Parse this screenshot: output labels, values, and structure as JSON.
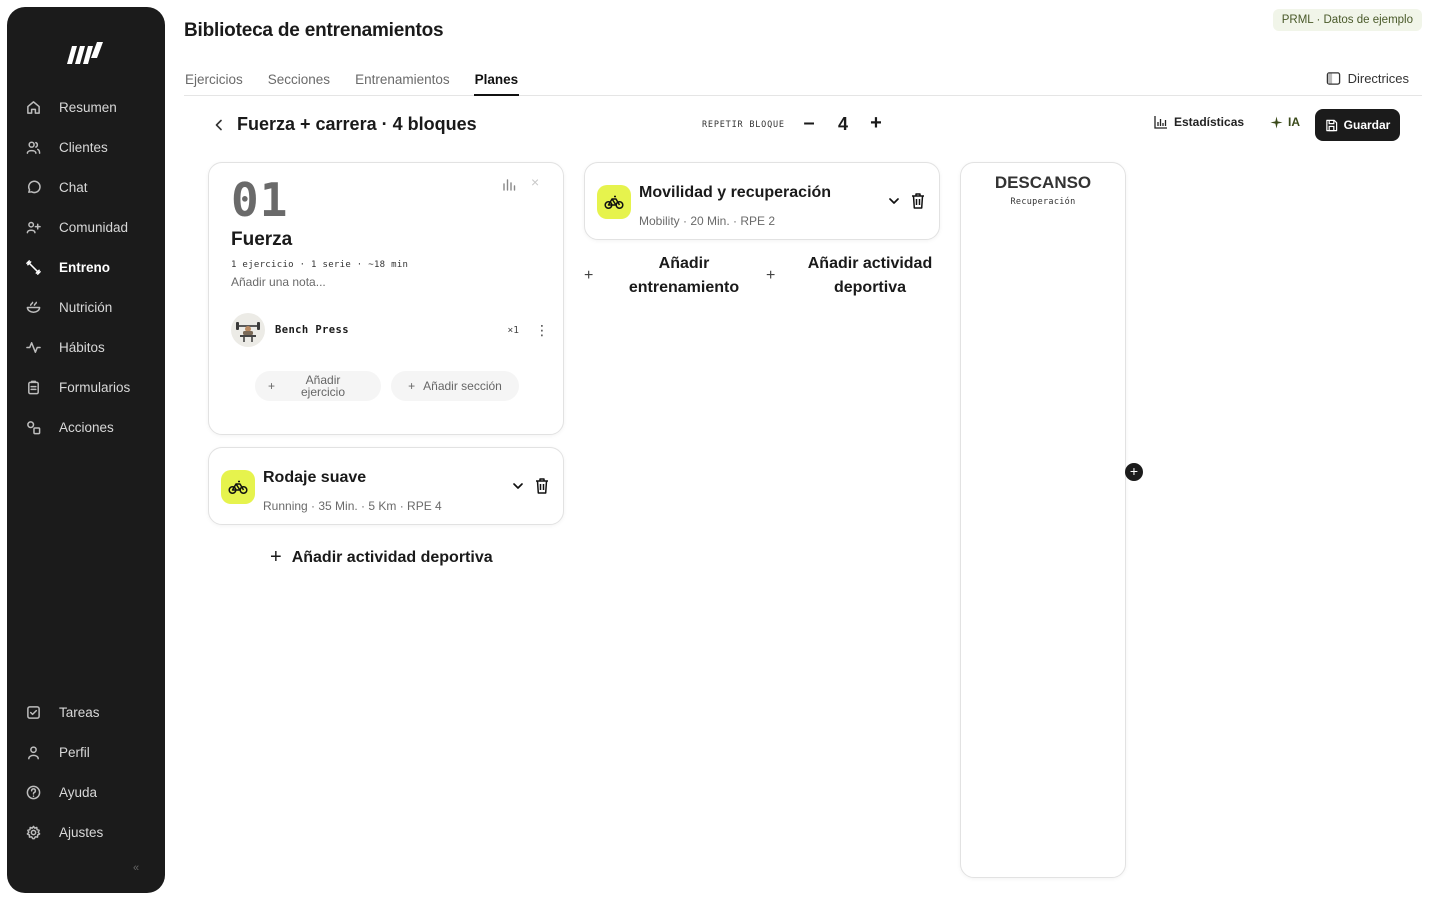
{
  "sidebar": {
    "logo": "logo",
    "items": [
      {
        "label": "Resumen",
        "icon": "home-icon"
      },
      {
        "label": "Clientes",
        "icon": "users-icon"
      },
      {
        "label": "Chat",
        "icon": "chat-icon"
      },
      {
        "label": "Comunidad",
        "icon": "community-icon"
      },
      {
        "label": "Entreno",
        "icon": "dumbbell-icon",
        "active": true
      },
      {
        "label": "Nutrición",
        "icon": "bowl-icon"
      },
      {
        "label": "Hábitos",
        "icon": "activity-icon"
      },
      {
        "label": "Formularios",
        "icon": "clipboard-icon"
      },
      {
        "label": "Acciones",
        "icon": "shapes-icon"
      }
    ],
    "bottom_items": [
      {
        "label": "Tareas",
        "icon": "checkbox-icon"
      },
      {
        "label": "Perfil",
        "icon": "user-icon"
      },
      {
        "label": "Ayuda",
        "icon": "help-icon"
      },
      {
        "label": "Ajustes",
        "icon": "settings-icon"
      }
    ],
    "collapse_glyph": "«"
  },
  "header": {
    "title": "Biblioteca de entrenamientos",
    "badge": "PRML · Datos de ejemplo",
    "tabs": [
      {
        "label": "Ejercicios"
      },
      {
        "label": "Secciones"
      },
      {
        "label": "Entrenamientos"
      },
      {
        "label": "Planes",
        "active": true
      }
    ],
    "directrices": "Directrices"
  },
  "plan": {
    "title": "Fuerza + carrera · 4 bloques",
    "repeat_label": "REPETIR BLOQUE",
    "minus": "–",
    "repeat_count": "4",
    "plus": "+",
    "stats_label": "Estadísticas",
    "ia_label": "IA",
    "save_label": "Guardar"
  },
  "block": {
    "number": "01",
    "close": "×",
    "name": "Fuerza",
    "meta": "1 ejercicio · 1 serie · ~18 min",
    "note_placeholder": "Añadir una nota...",
    "exercise": {
      "name": "Bench Press",
      "count": "×1",
      "menu": "⋮"
    },
    "add_exercise": "Añadir ejercicio",
    "add_section": "Añadir sección",
    "plus": "+"
  },
  "activities": {
    "rodaje": {
      "title": "Rodaje suave",
      "subtitle": "Running · 35 Min. · 5 Km · RPE 4"
    },
    "movilidad": {
      "title": "Movilidad y recuperación",
      "subtitle": "Mobility · 20 Min. · RPE 2"
    }
  },
  "actions": {
    "add_sport_activity": "Añadir actividad deportiva",
    "add_training": "Añadir entrenamiento",
    "add_sport_activity_2": "Añadir actividad deportiva",
    "plus": "+"
  },
  "rest": {
    "title": "DESCANSO",
    "subtitle": "Recuperación"
  },
  "colors": {
    "sidebar_bg": "#1b1b1b",
    "accent_lime": "#e6f34d",
    "badge_bg": "#f1f5e9"
  }
}
